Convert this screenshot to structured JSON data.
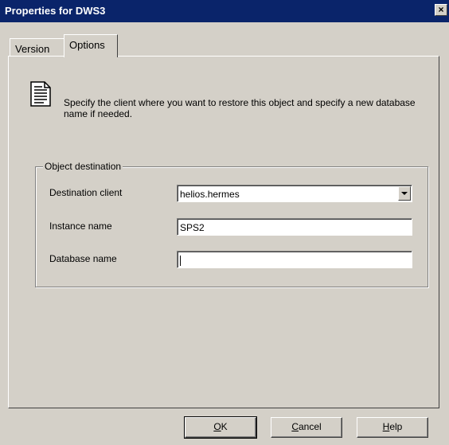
{
  "window": {
    "title": "Properties for DWS3"
  },
  "tabs": [
    {
      "label": "Version"
    },
    {
      "label": "Options"
    }
  ],
  "description": "Specify the client where you want to restore this object and specify a new database name if needed.",
  "group": {
    "title": "Object destination",
    "fields": {
      "client_label": "Destination client",
      "client_value": "helios.hermes",
      "instance_label": "Instance name",
      "instance_value": "SPS2",
      "db_label": "Database name",
      "db_value": ""
    }
  },
  "buttons": {
    "ok_u": "O",
    "ok_rest": "K",
    "cancel_u": "C",
    "cancel_rest": "ancel",
    "help_u": "H",
    "help_rest": "elp"
  },
  "icons": {
    "close": "close-icon",
    "document": "document-icon",
    "dropdown": "chevron-down-icon"
  }
}
